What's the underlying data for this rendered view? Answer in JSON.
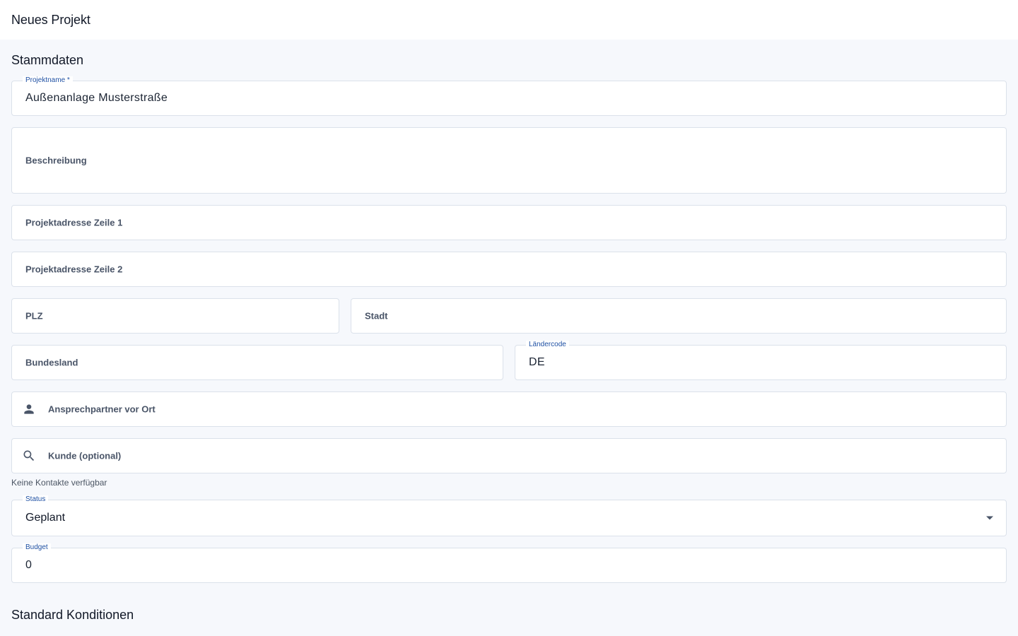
{
  "header": {
    "title": "Neues Projekt"
  },
  "sections": {
    "stammdaten": "Stammdaten",
    "konditionen": "Standard Konditionen"
  },
  "form": {
    "projektname": {
      "label": "Projektname *",
      "value": "Außenanlage Musterstraße"
    },
    "beschreibung": {
      "label": "Beschreibung"
    },
    "adresse1": {
      "label": "Projektadresse Zeile 1"
    },
    "adresse2": {
      "label": "Projektadresse Zeile 2"
    },
    "plz": {
      "label": "PLZ"
    },
    "stadt": {
      "label": "Stadt"
    },
    "bundesland": {
      "label": "Bundesland"
    },
    "laendercode": {
      "label": "Ländercode",
      "value": "DE"
    },
    "ansprechpartner": {
      "label": "Ansprechpartner vor Ort",
      "icon": "person-icon"
    },
    "kunde": {
      "label": "Kunde (optional)",
      "icon": "search-icon",
      "helper": "Keine Kontakte verfügbar"
    },
    "status": {
      "label": "Status",
      "value": "Geplant"
    },
    "budget": {
      "label": "Budget",
      "value": "0"
    }
  },
  "colors": {
    "accent": "#1d4fa3",
    "border": "#dbe1ea",
    "background": "#f6f8fc"
  }
}
